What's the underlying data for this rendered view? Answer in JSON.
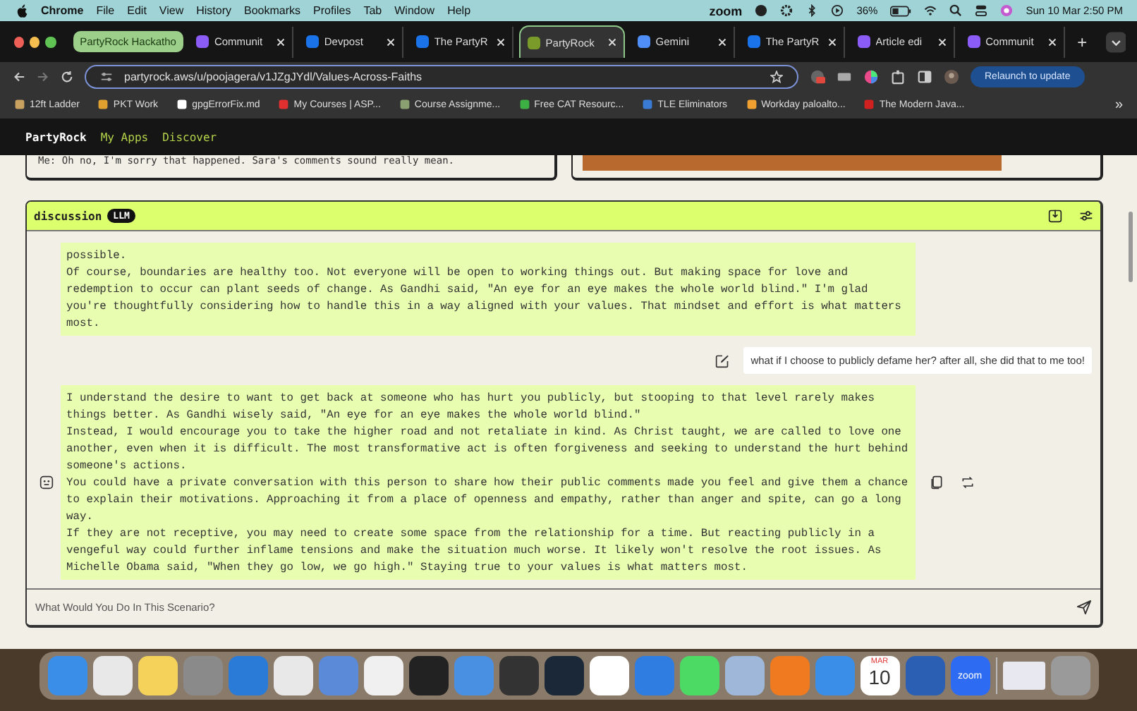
{
  "menu_bar": {
    "app": "Chrome",
    "items": [
      "File",
      "Edit",
      "View",
      "History",
      "Bookmarks",
      "Profiles",
      "Tab",
      "Window",
      "Help"
    ],
    "status": {
      "zoom": "zoom",
      "battery": "36%",
      "clock": "Sun 10 Mar 2:50 PM"
    }
  },
  "tabs": {
    "group_label": "PartyRock Hackatho",
    "items": [
      {
        "title": "Communit",
        "selected": false,
        "color": "#8b5cf6"
      },
      {
        "title": "Devpost",
        "selected": false,
        "color": "#1a73e8"
      },
      {
        "title": "The PartyR",
        "selected": false,
        "color": "#1a73e8"
      },
      {
        "title": "PartyRock",
        "selected": true,
        "color": "#7a9a2a"
      },
      {
        "title": "Gemini",
        "selected": false,
        "color": "#4f8ef7"
      },
      {
        "title": "The PartyR",
        "selected": false,
        "color": "#1a73e8"
      },
      {
        "title": "Article edi",
        "selected": false,
        "color": "#8b5cf6"
      },
      {
        "title": "Communit",
        "selected": false,
        "color": "#8b5cf6"
      }
    ],
    "new_tab": "+"
  },
  "address_bar": {
    "url": "partyrock.aws/u/poojagera/v1JZgJYdl/Values-Across-Faiths",
    "relaunch": "Relaunch to update"
  },
  "bookmarks": {
    "items": [
      {
        "label": "12ft Ladder",
        "color": "#c8a060"
      },
      {
        "label": "PKT Work",
        "color": "#e0a030"
      },
      {
        "label": "gpgErrorFix.md",
        "color": "#ffffff"
      },
      {
        "label": "My Courses | ASP...",
        "color": "#e03030"
      },
      {
        "label": "Course Assignme...",
        "color": "#8aa070"
      },
      {
        "label": "Free CAT Resourc...",
        "color": "#3cb043"
      },
      {
        "label": "TLE Eliminators",
        "color": "#3a7bd5"
      },
      {
        "label": "Workday paloalto...",
        "color": "#f0a030"
      },
      {
        "label": "The Modern Java...",
        "color": "#d02020"
      }
    ],
    "more": "»"
  },
  "app_nav": {
    "brand": "PartyRock",
    "links": [
      "My Apps",
      "Discover"
    ]
  },
  "previous_widget": {
    "text": "Me: Oh no, I'm sorry that happened. Sara's comments sound really mean."
  },
  "discussion": {
    "title": "discussion",
    "badge": "LLM",
    "messages": [
      {
        "kind": "assistant",
        "paragraphs": [
          "possible.",
          "Of course, boundaries are healthy too. Not everyone will be open to working things out. But making space for love and redemption to occur can plant seeds of change. As Gandhi said, \"An eye for an eye makes the whole world blind.\" I'm glad you're thoughtfully considering how to handle this in a way aligned with your values. That mindset and effort is what matters most."
        ]
      },
      {
        "kind": "user",
        "text": "what if I choose to publicly defame her? after all, she did that to me too!"
      },
      {
        "kind": "assistant",
        "paragraphs": [
          "I understand the desire to want to get back at someone who has hurt you publicly, but stooping to that level rarely makes things better. As Gandhi wisely said, \"An eye for an eye makes the whole world blind.\"",
          "Instead, I would encourage you to take the higher road and not retaliate in kind. As Christ taught, we are called to love one another, even when it is difficult. The most transformative act is often forgiveness and seeking to understand the hurt behind someone's actions.",
          "You could have a private conversation with this person to share how their public comments made you feel and give them a chance to explain their motivations. Approaching it from a place of openness and empathy, rather than anger and spite, can go a long way.",
          "If they are not receptive, you may need to create some space from the relationship for a time. But reacting publicly in a vengeful way could further inflame tensions and make the situation much worse. It likely won't resolve the root issues. As Michelle Obama said, \"When they go low, we go high.\" Staying true to your values is what matters most."
        ]
      }
    ],
    "input": {
      "placeholder": "What Would You Do In This Scenario?"
    }
  },
  "dock": {
    "items": [
      {
        "kind": "icon",
        "color": "#3b8ee8"
      },
      {
        "kind": "icon",
        "color": "#e8e8e8"
      },
      {
        "kind": "icon",
        "color": "#f5d35a"
      },
      {
        "kind": "icon",
        "color": "#8a8a8a"
      },
      {
        "kind": "icon",
        "color": "#2a7bd8"
      },
      {
        "kind": "icon",
        "color": "#e8e8e8"
      },
      {
        "kind": "icon",
        "color": "#5a8ad8"
      },
      {
        "kind": "icon",
        "color": "#f0f0f0"
      },
      {
        "kind": "icon",
        "color": "#222222"
      },
      {
        "kind": "icon",
        "color": "#4a90e2"
      },
      {
        "kind": "icon",
        "color": "#333333"
      },
      {
        "kind": "icon",
        "color": "#1b2838"
      },
      {
        "kind": "icon",
        "color": "#ffffff"
      },
      {
        "kind": "icon",
        "color": "#2f7de1"
      },
      {
        "kind": "icon",
        "color": "#4cd964"
      },
      {
        "kind": "icon",
        "color": "#9fb7d8"
      },
      {
        "kind": "icon",
        "color": "#f07a20"
      },
      {
        "kind": "icon",
        "color": "#3a8ee8"
      },
      {
        "kind": "calendar",
        "color": "#ffffff",
        "month": "MAR",
        "day": "10"
      },
      {
        "kind": "icon",
        "color": "#2b5fb4"
      },
      {
        "kind": "labeled",
        "color": "#2d6cf2",
        "label": "zoom"
      },
      {
        "kind": "window",
        "color": "#e8e8f0"
      },
      {
        "kind": "icon",
        "color": "#9a9a9a"
      }
    ]
  }
}
